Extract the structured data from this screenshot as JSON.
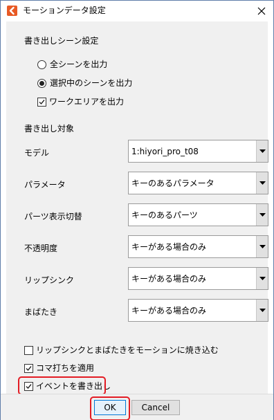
{
  "window": {
    "title": "モーションデータ設定",
    "app_icon": "cubism-logo-icon",
    "close_icon": "close-icon"
  },
  "scene_section": {
    "title": "書き出しシーン設定",
    "radio_all": {
      "label": "全シーンを出力",
      "checked": false
    },
    "radio_selected": {
      "label": "選択中のシーンを出力",
      "checked": true
    },
    "check_workarea": {
      "label": "ワークエリアを出力",
      "checked": true
    }
  },
  "target_section": {
    "title": "書き出し対象",
    "fields": [
      {
        "label": "モデル",
        "value": "1:hiyori_pro_t08"
      },
      {
        "label": "パラメータ",
        "value": "キーのあるパラメータ"
      },
      {
        "label": "パーツ表示切替",
        "value": "キーのあるパーツ"
      },
      {
        "label": "不透明度",
        "value": "キーがある場合のみ"
      },
      {
        "label": "リップシンク",
        "value": "キーがある場合のみ"
      },
      {
        "label": "まばたき",
        "value": "キーがある場合のみ"
      }
    ]
  },
  "options": {
    "bake_lipsync": {
      "label": "リップシンクとまばたきをモーションに焼き込む",
      "checked": false
    },
    "frame_step": {
      "label": "コマ打ちを適用",
      "checked": true
    },
    "export_events": {
      "label": "イベントを書き出し",
      "checked": true
    }
  },
  "buttons": {
    "ok_label": "OK",
    "cancel_label": "Cancel"
  },
  "colors": {
    "highlight": "#e31b23",
    "app_icon": "#e85a25",
    "default_button_border": "#0078d7"
  }
}
